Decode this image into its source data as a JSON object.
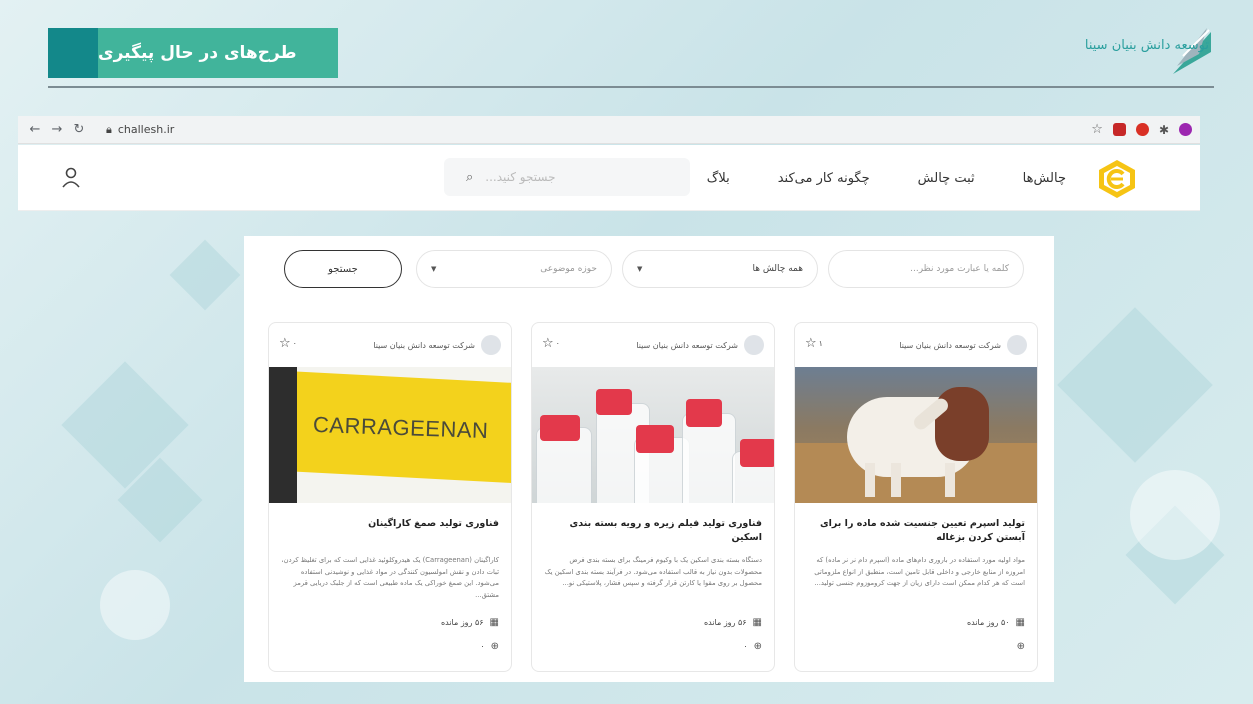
{
  "slide": {
    "title": "طرح‌های در حال پیگیری",
    "brand": "توسعه دانش بنیان سینا"
  },
  "browser": {
    "url": "challesh.ir"
  },
  "nav": {
    "links": [
      "چالش‌ها",
      "ثبت چالش",
      "چگونه کار می‌کند",
      "بلاگ"
    ],
    "search_placeholder": "جستجو کنید..."
  },
  "filters": {
    "keyword_placeholder": "کلمه یا عبارت مورد نظر...",
    "challenges_select": "همه چالش ها",
    "topic_select": "حوزه موضوعی",
    "search_button": "جستجو"
  },
  "cards": [
    {
      "company": "شرکت توسعه دانش بنیان سینا",
      "favorites": "۱",
      "title": "تولید اسپرم تعیین جنسیت شده ماده را برای آبستن کردن بزغاله",
      "description": "مواد اولیه مورد استفاده در باروری دام‌های ماده (اسپرم دام نر نر ماده) که امروزه از منابع خارجی و داخلی قابل تامین است، منطبق از انواع ملزوماتی است که هر کدام ممکن است دارای زیان از جهت کروموزوم جنسی تولید...",
      "days_left": "۵۰ روز مانده",
      "participants": ""
    },
    {
      "company": "شرکت توسعه دانش بنیان سینا",
      "favorites": "۰",
      "title": "فناوری تولید فیلم زیره و رویه بسته بندی اسکین",
      "description": "دستگاه بسته بندی اسکین یک با وکیوم فرمینگ برای بسته بندی فرض محصولات بدون نیاز به قالب استفاده می‌شود. در فرآیند بسته بندی اسکین یک محصول بر روی مقوا یا کارتن قرار گرفته و سپس فشار، پلاستیکی نو...",
      "days_left": "۵۶ روز مانده",
      "participants": "۰"
    },
    {
      "company": "شرکت توسعه دانش بنیان سینا",
      "favorites": "۰",
      "title": "فناوری تولید صمغ کاراگینان",
      "description": "کاراگینان (Carrageenan) یک هیدروکلوئید غذایی است که برای تغلیظ کردن، ثبات دادن و نقش امولسیون کنندگی در مواد غذایی و نوشیدنی استفاده می‌شود. این صمغ خوراکی یک ماده طبیعی است که از جلبک دریایی قرمز مشتق...",
      "days_left": "۵۶ روز مانده",
      "participants": "۰"
    }
  ],
  "carrageenan_label": "CARRAGEENAN"
}
